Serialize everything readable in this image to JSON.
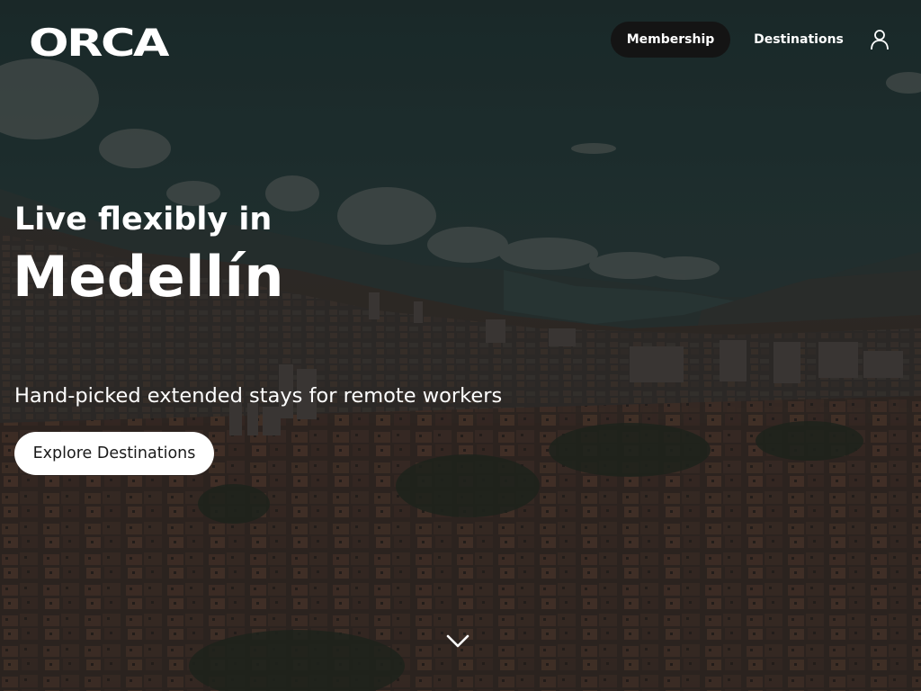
{
  "brand": {
    "logo_text": "ORCA"
  },
  "nav": {
    "membership_label": "Membership",
    "destinations_label": "Destinations",
    "account_icon": "user-icon"
  },
  "hero": {
    "tagline": "Live flexibly in",
    "city": "Medellín",
    "subtitle": "Hand-picked extended stays for remote workers",
    "cta_label": "Explore Destinations",
    "scroll_icon": "chevron-down-icon"
  },
  "colors": {
    "overlay_sky": "#243a3a",
    "nav_pill_bg": "#141414",
    "text": "#ffffff",
    "cta_bg": "#ffffff",
    "cta_text": "#1a1a1a"
  }
}
